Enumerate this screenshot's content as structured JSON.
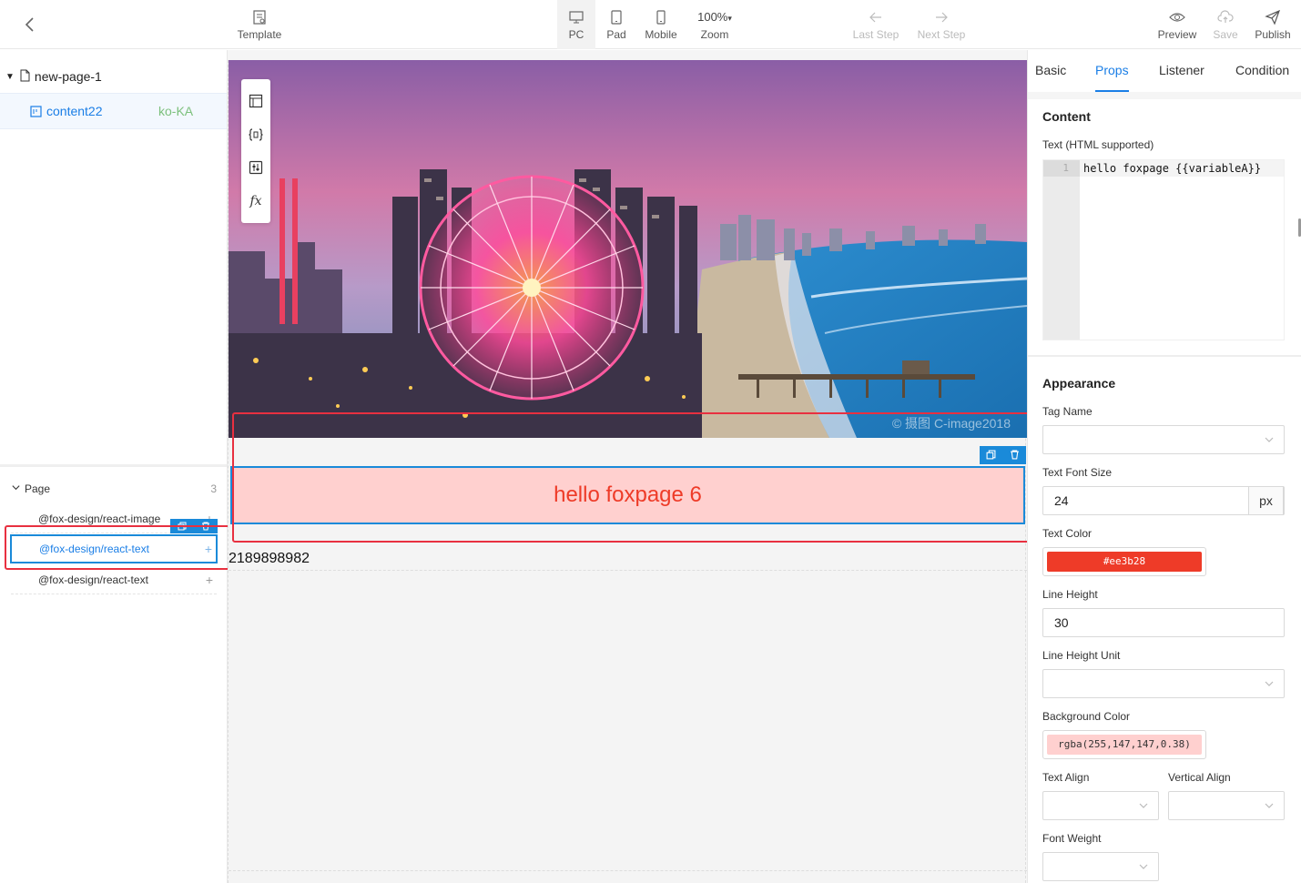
{
  "toolbar": {
    "template_label": "Template",
    "devices": [
      {
        "label": "PC",
        "active": true
      },
      {
        "label": "Pad",
        "active": false
      },
      {
        "label": "Mobile",
        "active": false
      }
    ],
    "zoom_value": "100%",
    "zoom_label": "Zoom",
    "last_step_label": "Last Step",
    "next_step_label": "Next Step",
    "preview_label": "Preview",
    "save_label": "Save",
    "publish_label": "Publish"
  },
  "left_panel": {
    "page_name": "new-page-1",
    "content_name": "content22",
    "content_locale": "ko-KA",
    "structure_title": "Page",
    "structure_count": "3",
    "components": [
      {
        "label": "@fox-design/react-image",
        "selected": false
      },
      {
        "label": "@fox-design/react-text",
        "selected": true
      },
      {
        "label": "@fox-design/react-text",
        "selected": false
      }
    ]
  },
  "canvas": {
    "watermark": "© 摄图 C-image2018",
    "text_block": "hello foxpage 6",
    "second_text": "2189898982",
    "float_tool_fx": "fx"
  },
  "right_panel": {
    "tabs": [
      {
        "label": "Basic",
        "active": false
      },
      {
        "label": "Props",
        "active": true
      },
      {
        "label": "Listener",
        "active": false
      },
      {
        "label": "Condition",
        "active": false
      }
    ],
    "content_title": "Content",
    "text_label": "Text (HTML supported)",
    "editor_line_number": "1",
    "editor_code": "hello foxpage {{variableA}}",
    "appearance_title": "Appearance",
    "tag_name_label": "Tag Name",
    "font_size_label": "Text Font Size",
    "font_size_value": "24",
    "font_size_unit": "px",
    "text_color_label": "Text Color",
    "text_color_value": "#ee3b28",
    "line_height_label": "Line Height",
    "line_height_value": "30",
    "line_height_unit_label": "Line Height Unit",
    "bg_color_label": "Background Color",
    "bg_color_value": "rgba(255,147,147,0.38)",
    "text_align_label": "Text Align",
    "vertical_align_label": "Vertical Align",
    "font_weight_label": "Font Weight"
  },
  "colors": {
    "accent": "#1a7ee6",
    "selection_blue": "#1a8ad9",
    "highlight_red": "#e83040",
    "text_color_swatch": "#ee3b28",
    "bg_swatch": "#ffd0cf"
  }
}
